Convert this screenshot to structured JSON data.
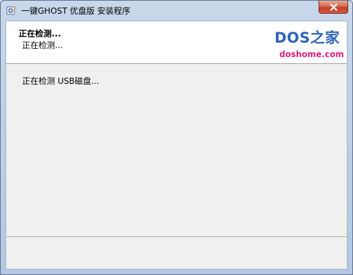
{
  "window": {
    "title": "一键GHOST 优盘版 安装程序",
    "close_label": "✕"
  },
  "header": {
    "title": "正在检测...",
    "subtitle": "正在检测..."
  },
  "logo": {
    "main_text": "DOS之家",
    "url_text": "doshome.com",
    "main_color": "#2f64b6",
    "url_color": "#e0207f"
  },
  "main": {
    "status": "正在检测 USB磁盘..."
  },
  "icons": {
    "app": "app-icon",
    "close": "close-icon"
  }
}
